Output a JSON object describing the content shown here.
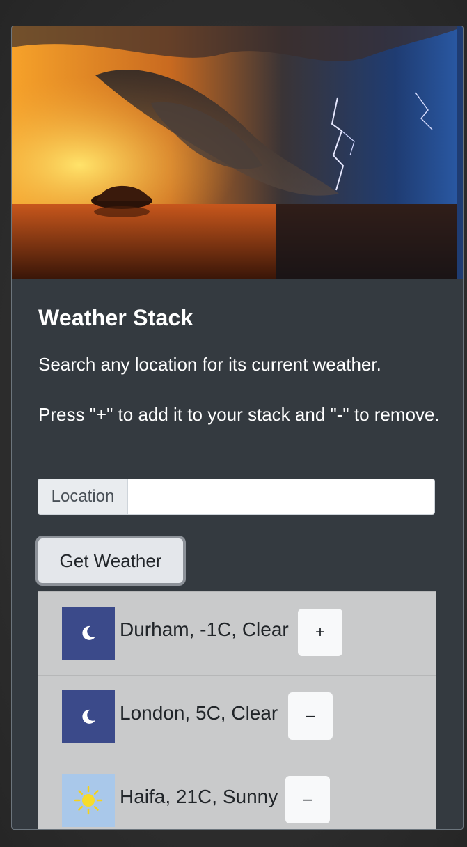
{
  "app": {
    "title": "Weather Stack",
    "description": "Search any location for its current weather.",
    "instructions": "Press \"+\" to add it to your stack and \"-\" to remove."
  },
  "search": {
    "prefix_label": "Location",
    "value": "",
    "placeholder": ""
  },
  "actions": {
    "get_weather_label": "Get Weather"
  },
  "stack": [
    {
      "text": "Durham, -1C, Clear",
      "icon": "moon-icon",
      "button": "+"
    },
    {
      "text": "London, 5C, Clear",
      "icon": "moon-icon",
      "button": "–"
    },
    {
      "text": "Haifa, 21C, Sunny",
      "icon": "sun-icon",
      "button": "–"
    }
  ],
  "colors": {
    "card_background": "#343a40",
    "moon_tile": "#3b4a8a",
    "sun_tile": "#a9c8ea",
    "list_item": "#c9cacb"
  }
}
